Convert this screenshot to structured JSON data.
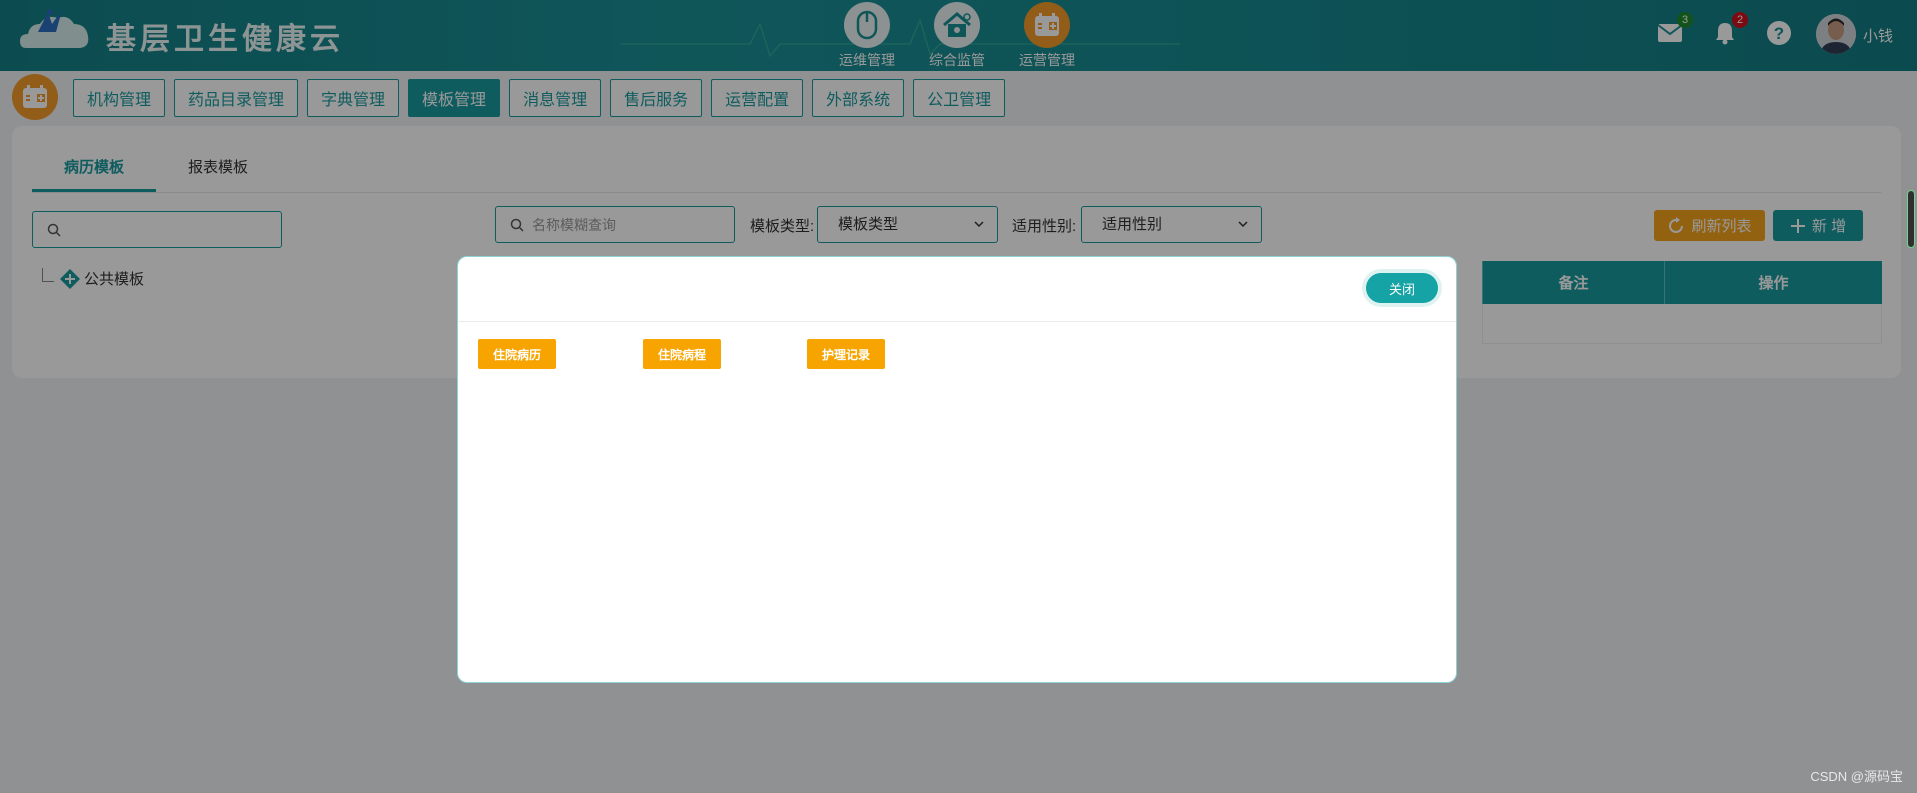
{
  "header": {
    "brand": "基层卫生健康云",
    "topnav": [
      {
        "label": "运维管理",
        "icon": "mouse-icon"
      },
      {
        "label": "综合监管",
        "icon": "home-gear-icon"
      },
      {
        "label": "运营管理",
        "icon": "calendar-plus-icon",
        "active": true
      }
    ],
    "mail_badge": "3",
    "bell_badge": "2",
    "help_glyph": "?",
    "username": "小钱"
  },
  "subnav": {
    "tabs": [
      "机构管理",
      "药品目录管理",
      "字典管理",
      "模板管理",
      "消息管理",
      "售后服务",
      "运营配置",
      "外部系统",
      "公卫管理"
    ],
    "active_index": 3
  },
  "content": {
    "tabs": [
      "病历模板",
      "报表模板"
    ],
    "active_tab": 0,
    "tree_root": "公共模板",
    "search_placeholder": "名称模糊查询",
    "filter_type_label": "模板类型:",
    "filter_type_value": "模板类型",
    "filter_gender_label": "适用性别:",
    "filter_gender_value": "适用性别",
    "refresh_label": "刷新列表",
    "add_label": "新 增",
    "table_headers": [
      "备注",
      "操作"
    ]
  },
  "modal": {
    "close_label": "关闭",
    "templates": [
      "住院病历",
      "住院病程",
      "护理记录"
    ]
  },
  "watermark": "CSDN @源码宝",
  "colors": {
    "teal": "#1a9a9f",
    "orange": "#f39a2b",
    "template_button": "#f7a400",
    "mail_badge": "#1f8a2e",
    "bell_badge": "#d0121b"
  }
}
